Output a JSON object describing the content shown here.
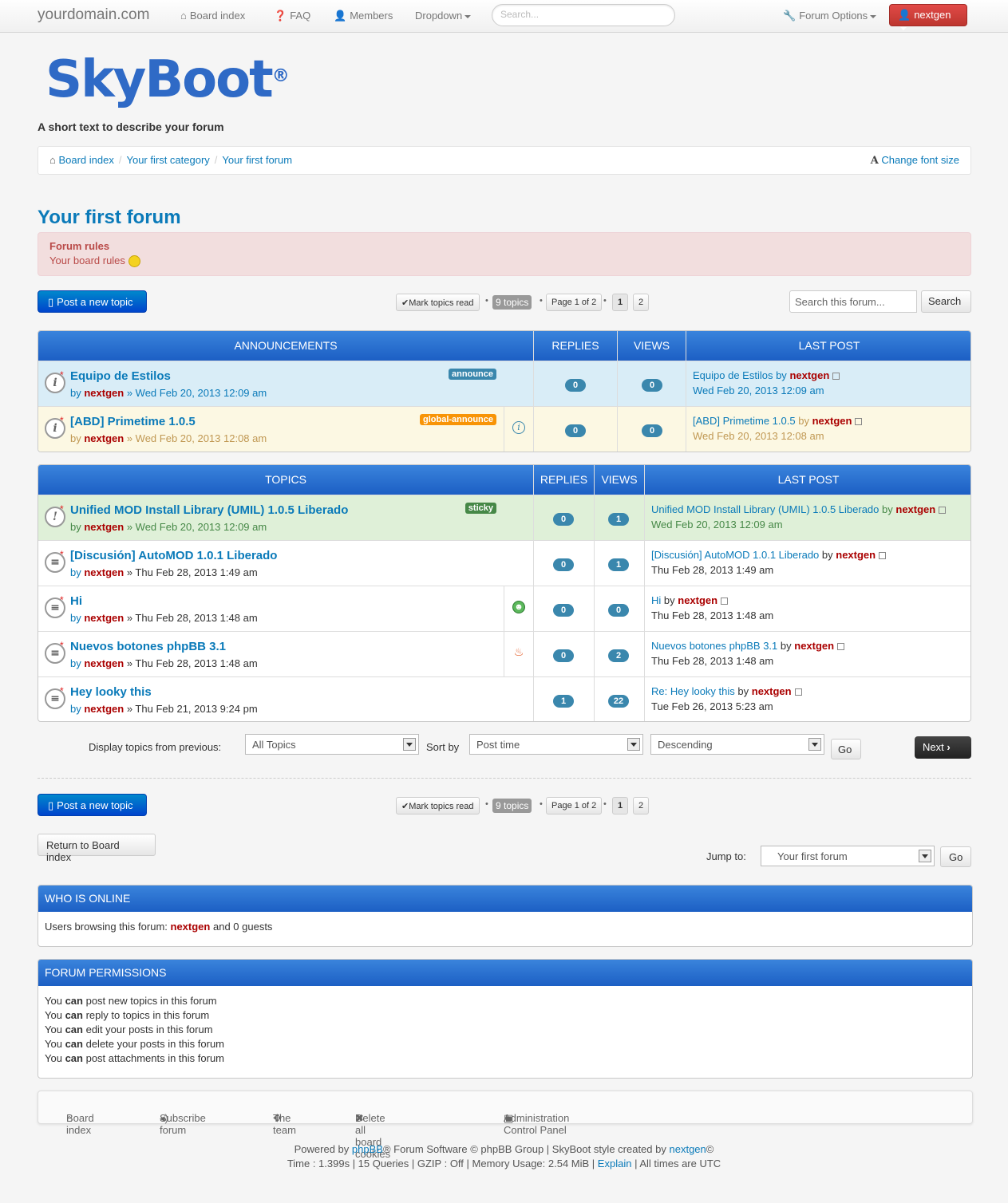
{
  "navbar": {
    "brand": "yourdomain.com",
    "board_index": "Board index",
    "faq": "FAQ",
    "members": "Members",
    "dropdown": "Dropdown",
    "search_placeholder": "Search...",
    "forum_options": "Forum Options",
    "username": "nextgen"
  },
  "header": {
    "logo": "SkyBoot",
    "tagline": "A short text to describe your forum"
  },
  "breadcrumb": {
    "items": [
      "Board index",
      "Your first category",
      "Your first forum"
    ],
    "font_size": "Change font size"
  },
  "forum": {
    "title": "Your first forum",
    "rules_title": "Forum rules",
    "rules_text": "Your board rules"
  },
  "actions": {
    "post_new_topic": "Post a new topic",
    "mark_read": "Mark topics read",
    "topic_count": "9 topics",
    "page_info": "Page 1 of 2",
    "pages": [
      "1",
      "2"
    ],
    "search_placeholder": "Search this forum...",
    "search_btn": "Search"
  },
  "announcements": {
    "headers": [
      "ANNOUNCEMENTS",
      "REPLIES",
      "VIEWS",
      "LAST POST"
    ],
    "rows": [
      {
        "title": "Equipo de Estilos",
        "label": "announce",
        "by": "by",
        "author": "nextgen",
        "date": "» Wed Feb 20, 2013 12:09 am",
        "replies": "0",
        "views": "0",
        "lp_title": "Equipo de Estilos",
        "lp_by": "by",
        "lp_author": "nextgen",
        "lp_date": "Wed Feb 20, 2013 12:09 am"
      },
      {
        "title": "[ABD] Primetime 1.0.5",
        "label": "global-announce",
        "by": "by",
        "author": "nextgen",
        "date": "» Wed Feb 20, 2013 12:08 am",
        "replies": "0",
        "views": "0",
        "lp_title": "[ABD] Primetime 1.0.5",
        "lp_by": "by",
        "lp_author": "nextgen",
        "lp_date": "Wed Feb 20, 2013 12:08 am"
      }
    ]
  },
  "topics": {
    "headers": [
      "TOPICS",
      "REPLIES",
      "VIEWS",
      "LAST POST"
    ],
    "rows": [
      {
        "title": "Unified MOD Install Library (UMIL) 1.0.5 Liberado",
        "label": "sticky",
        "by": "by",
        "author": "nextgen",
        "date": "» Wed Feb 20, 2013 12:09 am",
        "replies": "0",
        "views": "1",
        "lp_title": "Unified MOD Install Library (UMIL) 1.0.5 Liberado",
        "lp_by": "by",
        "lp_author": "nextgen",
        "lp_date": "Wed Feb 20, 2013 12:09 am"
      },
      {
        "title": "[Discusión] AutoMOD 1.0.1 Liberado",
        "by": "by",
        "author": "nextgen",
        "date": "» Thu Feb 28, 2013 1:49 am",
        "replies": "0",
        "views": "1",
        "lp_title": "[Discusión] AutoMOD 1.0.1 Liberado",
        "lp_by": "by",
        "lp_author": "nextgen",
        "lp_date": "Thu Feb 28, 2013 1:49 am"
      },
      {
        "title": "Hi",
        "by": "by",
        "author": "nextgen",
        "date": "» Thu Feb 28, 2013 1:48 am",
        "replies": "0",
        "views": "0",
        "lp_title": "Hi",
        "lp_by": "by",
        "lp_author": "nextgen",
        "lp_date": "Thu Feb 28, 2013 1:48 am"
      },
      {
        "title": "Nuevos botones phpBB 3.1",
        "by": "by",
        "author": "nextgen",
        "date": "» Thu Feb 28, 2013 1:48 am",
        "replies": "0",
        "views": "2",
        "lp_title": "Nuevos botones phpBB 3.1",
        "lp_by": "by",
        "lp_author": "nextgen",
        "lp_date": "Thu Feb 28, 2013 1:48 am"
      },
      {
        "title": "Hey looky this",
        "by": "by",
        "author": "nextgen",
        "date": "» Thu Feb 21, 2013 9:24 pm",
        "replies": "1",
        "views": "22",
        "lp_title": "Re: Hey looky this",
        "lp_by": "by",
        "lp_author": "nextgen",
        "lp_date": "Tue Feb 26, 2013 5:23 am"
      }
    ]
  },
  "sorting": {
    "display_label": "Display topics from previous:",
    "display_value": "All Topics",
    "sort_label": "Sort by",
    "sort_value": "Post time",
    "order_value": "Descending",
    "go": "Go",
    "next": "Next"
  },
  "bottom": {
    "return": "Return to Board index",
    "jump_label": "Jump to:",
    "jump_value": "Your first forum",
    "go": "Go"
  },
  "online": {
    "title": "WHO IS ONLINE",
    "prefix": "Users browsing this forum:",
    "user": "nextgen",
    "suffix": "and 0 guests"
  },
  "permissions": {
    "title": "FORUM PERMISSIONS",
    "you": "You",
    "can": "can",
    "items": [
      "post new topics in this forum",
      "reply to topics in this forum",
      "edit your posts in this forum",
      "delete your posts in this forum",
      "post attachments in this forum"
    ]
  },
  "footer": {
    "links": [
      "Board index",
      "Subscribe forum",
      "The team",
      "Delete all board cookies",
      "Administration Control Panel"
    ],
    "powered_by": "Powered by",
    "phpbb": "phpBB",
    "powered_rest": "® Forum Software © phpBB Group | SkyBoot style created by",
    "creator": "nextgen",
    "creator_mark": "©",
    "stats": "Time : 1.399s | 15 Queries | GZIP : Off | Memory Usage: 2.54 MiB |",
    "explain": "Explain",
    "timezone": "| All times are UTC"
  },
  "colors": {
    "header_blue": "#1c5fc4",
    "link": "#0a7ab9",
    "user": "#aa0000",
    "announce_bg": "#d9edf7",
    "global_bg": "#fcf8e3",
    "sticky_bg": "#dff0d8",
    "badge": "#3a87ad",
    "label_announce": "#3a87ad",
    "label_global": "#f89406",
    "label_sticky": "#468847"
  }
}
